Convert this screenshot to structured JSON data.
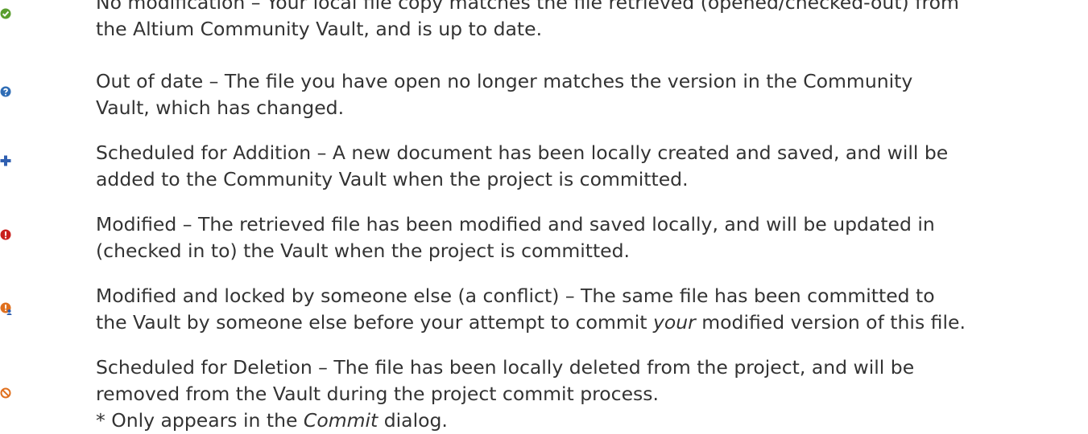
{
  "items": [
    {
      "icon": "check-icon",
      "color": "#5a9e2f",
      "lines": [
        "No modification – Your local file copy matches the file retrieved (opened/checked-out) from",
        "the Altium Community Vault, and is up to date."
      ]
    },
    {
      "icon": "question-icon",
      "color": "#2f6db5",
      "lines": [
        "Out of date – The file you have open no longer matches the version in the Community",
        "Vault, which has changed."
      ]
    },
    {
      "icon": "plus-icon",
      "color": "#2f5fb0",
      "lines": [
        "Scheduled for Addition – A new document has been locally created and saved, and will be",
        "added to the Community Vault when the project is committed."
      ]
    },
    {
      "icon": "exclamation-icon",
      "color": "#c9211e",
      "lines": [
        "Modified – The retrieved file has been modified and saved locally, and will be updated in",
        "(checked in to) the Vault when the project is committed."
      ]
    },
    {
      "icon": "conflict-user-icon",
      "color": "#e0701e",
      "lines": [
        "Modified and locked by someone else (a conflict) – The same file has been committed to"
      ],
      "line2_before": "the Vault by someone else before your attempt to commit ",
      "line2_em": "your",
      "line2_after": " modified version of this file."
    },
    {
      "icon": "prohibited-icon",
      "color": "#e0701e",
      "lines": [
        "Scheduled for Deletion – The file has been locally deleted from the project, and will be",
        "removed from the Vault during the project commit process."
      ],
      "line3_before": "* Only appears in the ",
      "line3_em": "Commit",
      "line3_after": " dialog."
    }
  ]
}
